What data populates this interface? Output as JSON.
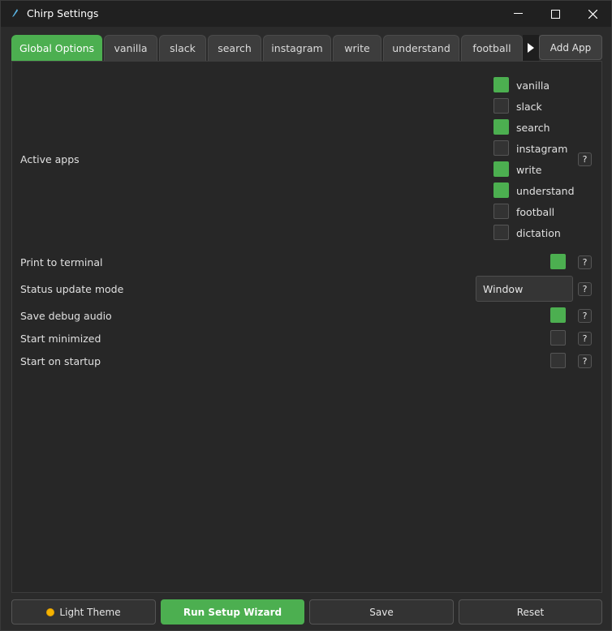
{
  "window": {
    "title": "Chirp Settings",
    "controls": {
      "minimize_icon": "minimize-icon",
      "maximize_icon": "maximize-icon",
      "close_icon": "close-icon"
    }
  },
  "tabs": [
    {
      "label": "Global Options",
      "active": true
    },
    {
      "label": "vanilla",
      "active": false
    },
    {
      "label": "slack",
      "active": false
    },
    {
      "label": "search",
      "active": false
    },
    {
      "label": "instagram",
      "active": false
    },
    {
      "label": "write",
      "active": false
    },
    {
      "label": "understand",
      "active": false
    },
    {
      "label": "football",
      "active": false
    }
  ],
  "add_app_label": "Add App",
  "settings": {
    "active_apps": {
      "label": "Active apps",
      "apps": [
        {
          "name": "vanilla",
          "checked": true
        },
        {
          "name": "slack",
          "checked": false
        },
        {
          "name": "search",
          "checked": true
        },
        {
          "name": "instagram",
          "checked": false
        },
        {
          "name": "write",
          "checked": true
        },
        {
          "name": "understand",
          "checked": true
        },
        {
          "name": "football",
          "checked": false
        },
        {
          "name": "dictation",
          "checked": false
        }
      ]
    },
    "print_to_terminal": {
      "label": "Print to terminal",
      "checked": true
    },
    "status_update_mode": {
      "label": "Status update mode",
      "value": "Window"
    },
    "save_debug_audio": {
      "label": "Save debug audio",
      "checked": true
    },
    "start_minimized": {
      "label": "Start minimized",
      "checked": false
    },
    "start_on_startup": {
      "label": "Start on startup",
      "checked": false
    },
    "help_label": "?"
  },
  "footer": {
    "theme_label": "Light Theme",
    "wizard_label": "Run Setup Wizard",
    "save_label": "Save",
    "reset_label": "Reset"
  },
  "colors": {
    "accent": "#4caf50",
    "background": "#2b2b2b",
    "panel": "#272727"
  }
}
